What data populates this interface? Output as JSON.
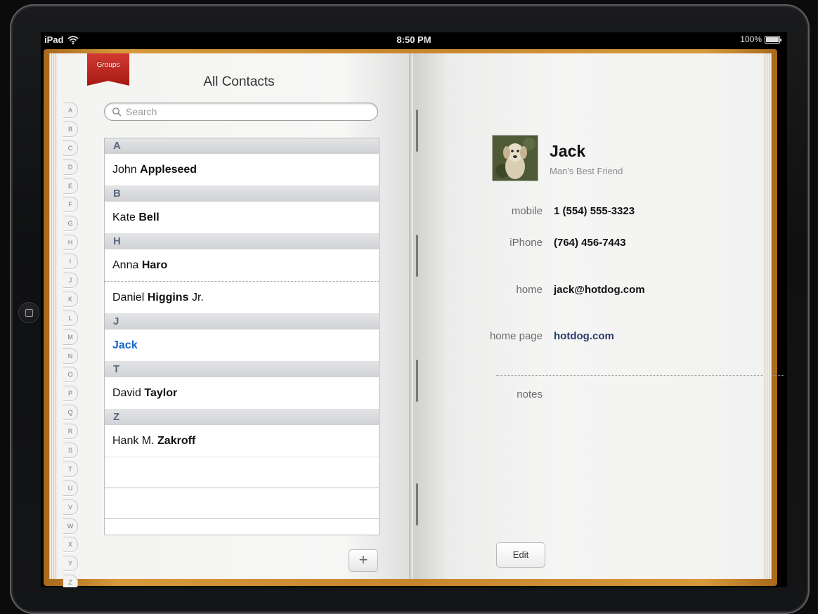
{
  "status_bar": {
    "device": "iPad",
    "time": "8:50 PM",
    "battery_percent": "100%"
  },
  "contacts_list": {
    "groups_label": "Groups",
    "title": "All Contacts",
    "search_placeholder": "Search",
    "index_letters": [
      "A",
      "B",
      "C",
      "D",
      "E",
      "F",
      "G",
      "H",
      "I",
      "J",
      "K",
      "L",
      "M",
      "N",
      "O",
      "P",
      "Q",
      "R",
      "S",
      "T",
      "U",
      "V",
      "W",
      "X",
      "Y",
      "Z",
      "#"
    ],
    "sections": [
      {
        "letter": "A",
        "rows": [
          {
            "first": "John",
            "last": "Appleseed",
            "suffix": ""
          }
        ]
      },
      {
        "letter": "B",
        "rows": [
          {
            "first": "Kate",
            "last": "Bell",
            "suffix": ""
          }
        ]
      },
      {
        "letter": "H",
        "rows": [
          {
            "first": "Anna",
            "last": "Haro",
            "suffix": ""
          },
          {
            "first": "Daniel",
            "last": "Higgins",
            "suffix": "Jr."
          }
        ]
      },
      {
        "letter": "J",
        "rows": [
          {
            "first": "",
            "last": "Jack",
            "suffix": "",
            "selected": true
          }
        ]
      },
      {
        "letter": "T",
        "rows": [
          {
            "first": "David",
            "last": "Taylor",
            "suffix": ""
          }
        ]
      },
      {
        "letter": "Z",
        "rows": [
          {
            "first": "Hank M.",
            "last": "Zakroff",
            "suffix": ""
          }
        ]
      }
    ],
    "add_button_label": "+"
  },
  "contact_detail": {
    "name": "Jack",
    "subtitle": "Man's Best Friend",
    "fields": [
      {
        "label": "mobile",
        "value": "1 (554) 555-3323",
        "link": false
      },
      {
        "label": "iPhone",
        "value": "(764) 456-7443",
        "link": false
      },
      {
        "label": "home",
        "value": "jack@hotdog.com",
        "link": false
      },
      {
        "label": "home page",
        "value": "hotdog.com",
        "link": true
      }
    ],
    "notes_label": "notes",
    "edit_button_label": "Edit"
  },
  "colors": {
    "selected_row_text": "#1464c8",
    "groups_ribbon": "#c0271f",
    "book_cover": "#c8862e"
  }
}
